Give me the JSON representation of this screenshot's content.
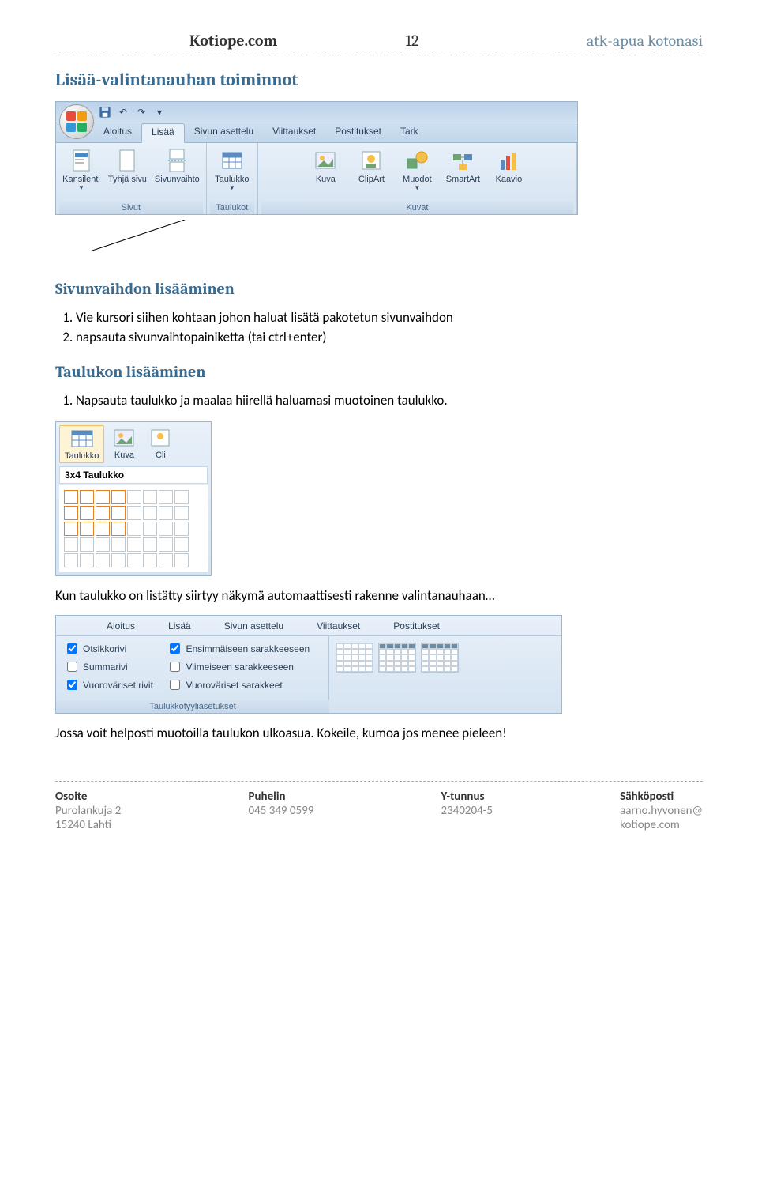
{
  "header": {
    "left": "Kotiope.com",
    "center": "12",
    "right": "atk-apua kotonasi"
  },
  "sections": {
    "main_heading": "Lisää-valintanauhan toiminnot",
    "sub1_heading": "Sivunvaihdon lisääminen",
    "sub1_list": [
      "Vie kursori siihen kohtaan johon haluat lisätä pakotetun sivunvaihdon",
      "napsauta sivunvaihtopainiketta (tai ctrl+enter)"
    ],
    "sub2_heading": "Taulukon lisääminen",
    "sub2_list": [
      "Napsauta taulukko ja maalaa hiirellä haluamasi muotoinen taulukko."
    ],
    "para_after_grid": "Kun taulukko on listätty siirtyy näkymä automaattisesti rakenne valintanauhaan…",
    "para_final": "Jossa voit helposti muotoilla taulukon ulkoasua. Kokeile, kumoa jos menee pieleen!"
  },
  "ribbon1": {
    "tabs": [
      "Aloitus",
      "Lisää",
      "Sivun asettelu",
      "Viittaukset",
      "Postitukset",
      "Tark"
    ],
    "active_tab": "Lisää",
    "groups": {
      "sivut": {
        "label": "Sivut",
        "items": [
          "Kansilehti",
          "Tyhjä sivu",
          "Sivunvaihto"
        ]
      },
      "taulukot": {
        "label": "Taulukot",
        "items": [
          "Taulukko"
        ]
      },
      "kuvat": {
        "label": "Kuvat",
        "items": [
          "Kuva",
          "ClipArt",
          "Muodot",
          "SmartArt",
          "Kaavio"
        ]
      }
    }
  },
  "smallpanel": {
    "buttons": [
      "Taulukko",
      "Kuva",
      "Cli"
    ],
    "grid_title": "3x4 Taulukko",
    "sel_rows": 3,
    "sel_cols": 4,
    "total_rows": 5,
    "total_cols": 8
  },
  "ribbon3": {
    "tabs": [
      "Aloitus",
      "Lisää",
      "Sivun asettelu",
      "Viittaukset",
      "Postitukset"
    ],
    "checks_col1": [
      {
        "label": "Otsikkorivi",
        "checked": true
      },
      {
        "label": "Summarivi",
        "checked": false
      },
      {
        "label": "Vuoroväriset rivit",
        "checked": true
      }
    ],
    "checks_col2": [
      {
        "label": "Ensimmäiseen sarakkeeseen",
        "checked": true
      },
      {
        "label": "Viimeiseen sarakkeeseen",
        "checked": false
      },
      {
        "label": "Vuoroväriset sarakkeet",
        "checked": false
      }
    ],
    "group_label": "Taulukkotyyliasetukset"
  },
  "footer": {
    "c1": {
      "h": "Osoite",
      "l1": "Purolankuja 2",
      "l2": "15240 Lahti"
    },
    "c2": {
      "h": "Puhelin",
      "l1": "045 349 0599",
      "l2": ""
    },
    "c3": {
      "h": "Y-tunnus",
      "l1": "2340204-5",
      "l2": ""
    },
    "c4": {
      "h": "Sähköposti",
      "l1": "aarno.hyvonen@",
      "l2": "kotiope.com"
    }
  }
}
